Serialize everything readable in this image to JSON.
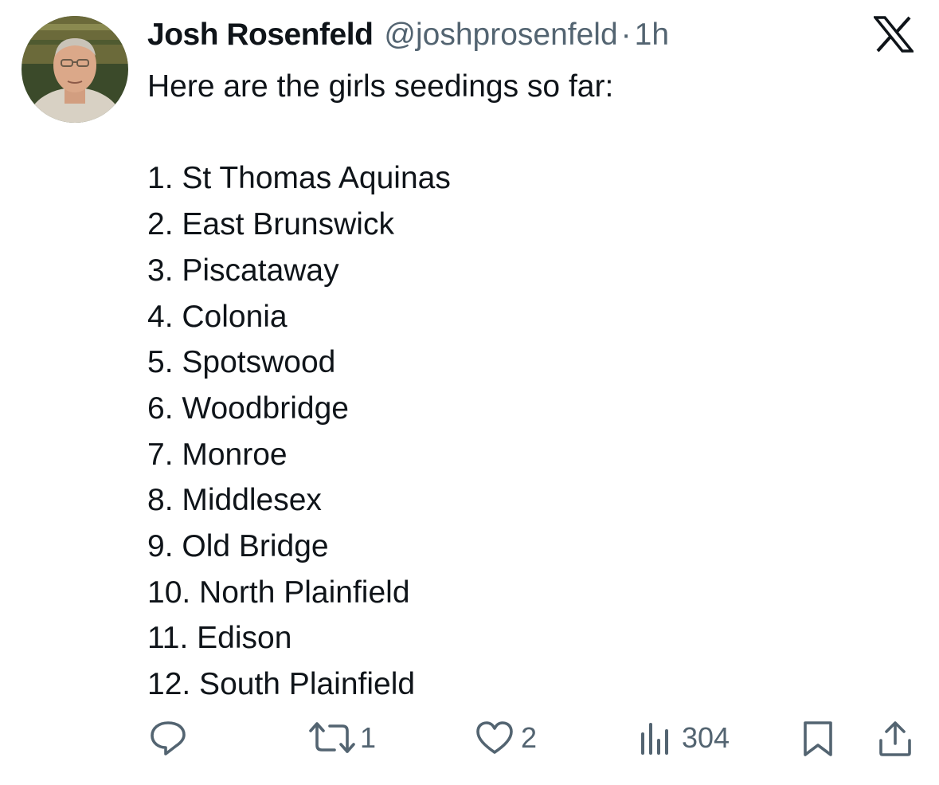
{
  "tweet": {
    "author_name": "Josh Rosenfeld",
    "author_handle": "@joshprosenfeld",
    "separator": "·",
    "time": "1h",
    "intro": "Here are the girls seedings so far:",
    "seedings": [
      "1. St Thomas Aquinas",
      "2. East Brunswick",
      "3. Piscataway",
      "4. Colonia",
      "5. Spotswood",
      "6. Woodbridge",
      "7. Monroe",
      "8. Middlesex",
      "9. Old Bridge",
      "10. North Plainfield",
      "11. Edison",
      "12. South Plainfield"
    ]
  },
  "actions": {
    "reply_count": "",
    "retweet_count": "1",
    "like_count": "2",
    "views_count": "304"
  },
  "icons": {
    "brand": "x-logo-icon",
    "reply": "reply-icon",
    "retweet": "retweet-icon",
    "like": "heart-icon",
    "views": "views-icon",
    "bookmark": "bookmark-icon",
    "share": "share-icon"
  },
  "colors": {
    "text": "#0f1419",
    "secondary": "#536471",
    "background": "#ffffff"
  }
}
